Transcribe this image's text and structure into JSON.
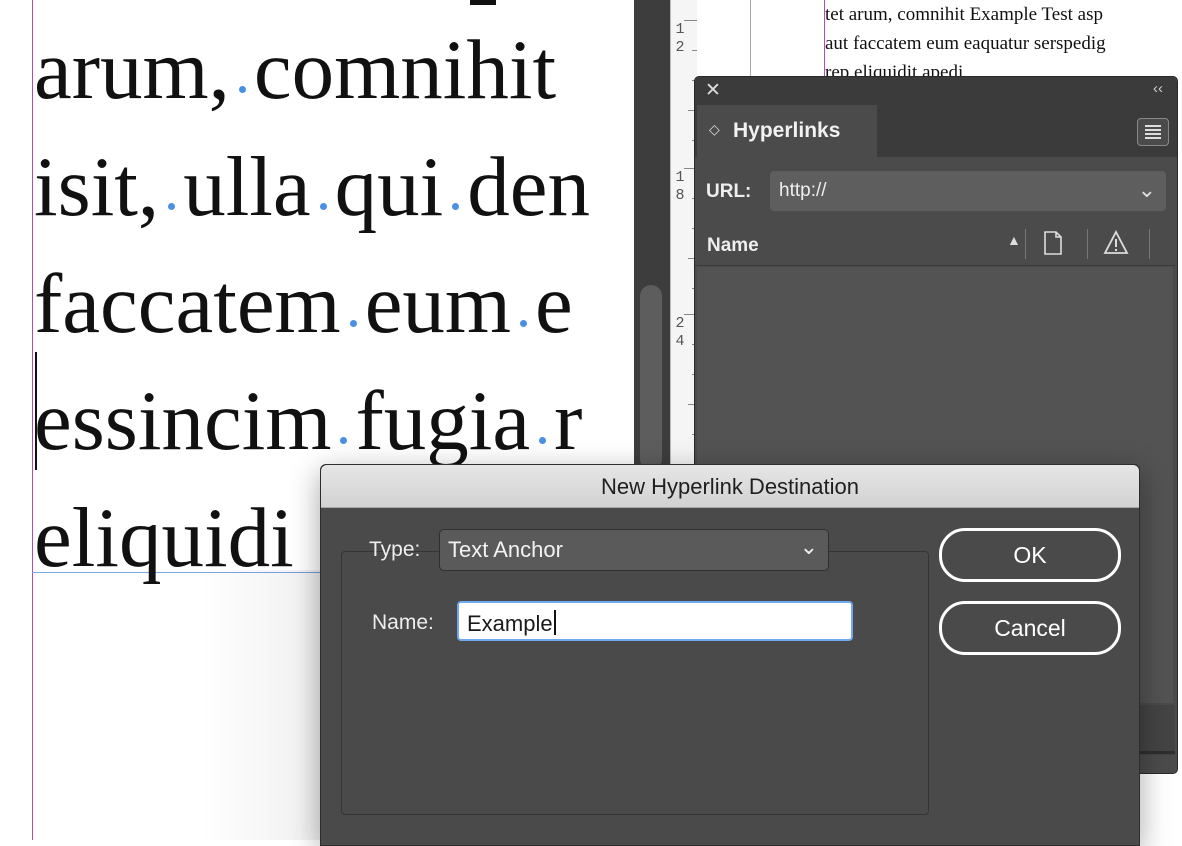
{
  "document": {
    "lines": [
      [
        "arum,",
        "comnihit"
      ],
      [
        "isit,",
        "ulla",
        "qui",
        "den"
      ],
      [
        "faccatem",
        "eum",
        "e"
      ],
      [
        "essincim",
        "fugia",
        "r"
      ],
      [
        "eliquidi"
      ]
    ],
    "line_1_word_1": "arum,",
    "line_1_word_2": "comnihit",
    "line_2_word_1": "isit,",
    "line_2_word_2": "ulla",
    "line_2_word_3": "qui",
    "line_2_word_4": "den",
    "line_3_word_1": "faccatem",
    "line_3_word_2": "eum",
    "line_3_word_3": "e",
    "line_4_word_1": "essincim",
    "line_4_word_2": "fugia",
    "line_4_word_3": "r",
    "line_5_word_1": "eliquidi"
  },
  "ruler": {
    "labels": [
      "1",
      "2",
      "1",
      "8",
      "2",
      "4"
    ]
  },
  "right_page": {
    "lines": [
      "tet arum, comnihit Example Test asp",
      "aut faccatem eum eaquatur serspedig",
      "rep eliquidit apedi"
    ]
  },
  "hyperlinks_panel": {
    "tab_label": "Hyperlinks",
    "url_label": "URL:",
    "url_value": "http://",
    "column_name": "Name",
    "icons": [
      "close-icon",
      "collapse-icon",
      "panel-menu-icon",
      "sort-up-icon",
      "page-icon",
      "warning-icon",
      "chevron-down-icon"
    ]
  },
  "dialog": {
    "title": "New Hyperlink Destination",
    "type_label": "Type:",
    "type_value": "Text Anchor",
    "name_label": "Name:",
    "name_value": "Example",
    "ok_label": "OK",
    "cancel_label": "Cancel"
  },
  "colors": {
    "panel_bg": "#4b4b4b",
    "dialog_bg": "#4a4a4a",
    "focus_ring": "#6ea8f0",
    "space_marker": "#4a90e2",
    "margin_guide": "#b44bb4"
  }
}
